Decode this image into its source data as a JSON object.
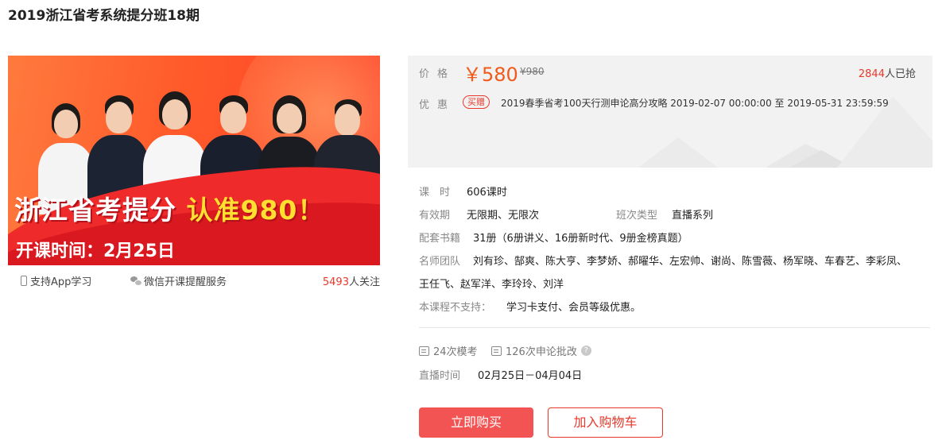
{
  "page": {
    "title": "2019浙江省考系统提分班18期"
  },
  "banner": {
    "headline_white": "浙江省考提分 ",
    "headline_yellow": "认准980！",
    "date": "开课时间：2月25日"
  },
  "features": {
    "app": "支持App学习",
    "wechat": "微信开课提醒服务",
    "follow_count": "5493",
    "follow_suffix": "人关注"
  },
  "price": {
    "label": "价格",
    "current": "￥580",
    "original": "¥980",
    "buyers_count": "2844",
    "buyers_suffix": "人已抢",
    "promo_label": "优惠",
    "promo_badge": "买赠",
    "promo_text": "2019春季省考100天行测申论高分攻略  2019-02-07 00:00:00 至 2019-05-31 23:59:59"
  },
  "info": {
    "hours_label": "课　时",
    "hours_value": "606课时",
    "validity_label": "有效期",
    "validity_value": "无限期、无限次",
    "class_type_label": "班次类型",
    "class_type_value": "直播系列",
    "books_label": "配套书籍",
    "books_value": "31册（6册讲义、16册新时代、9册金榜真题）",
    "teachers_label": "名师团队",
    "teachers_line1": "刘有珍、郜爽、陈大亨、李梦娇、郝曜华、左宏帅、谢尚、陈雪薇、杨军晓、车春艺、李彩凤、",
    "teachers_line2": "王任飞、赵军洋、李玲玲、刘洋",
    "unsupported_label": "本课程不支持：",
    "unsupported_value": "学习卡支付、会员等级优惠。"
  },
  "services": {
    "mock": "24次模考",
    "essay": "126次申论批改",
    "help": "?"
  },
  "live": {
    "label": "直播时间",
    "value": "02月25日－04月04日"
  },
  "buttons": {
    "buy": "立即购买",
    "cart": "加入购物车"
  },
  "colors": {
    "accent": "#e8392a",
    "buy_button": "#f25353",
    "price": "#f05a1a"
  }
}
